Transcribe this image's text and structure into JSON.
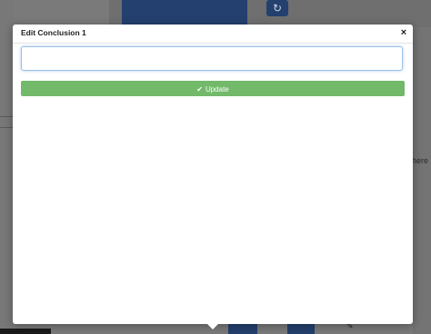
{
  "background": {
    "right_partial_text": "here",
    "refresh_icon": "refresh-icon"
  },
  "modal": {
    "title": "Edit Conclusion 1",
    "close_glyph": "×",
    "input": {
      "value": "",
      "placeholder": ""
    },
    "update_button": {
      "label": "Update",
      "icon": "check-icon",
      "color": "#72b96a"
    }
  }
}
